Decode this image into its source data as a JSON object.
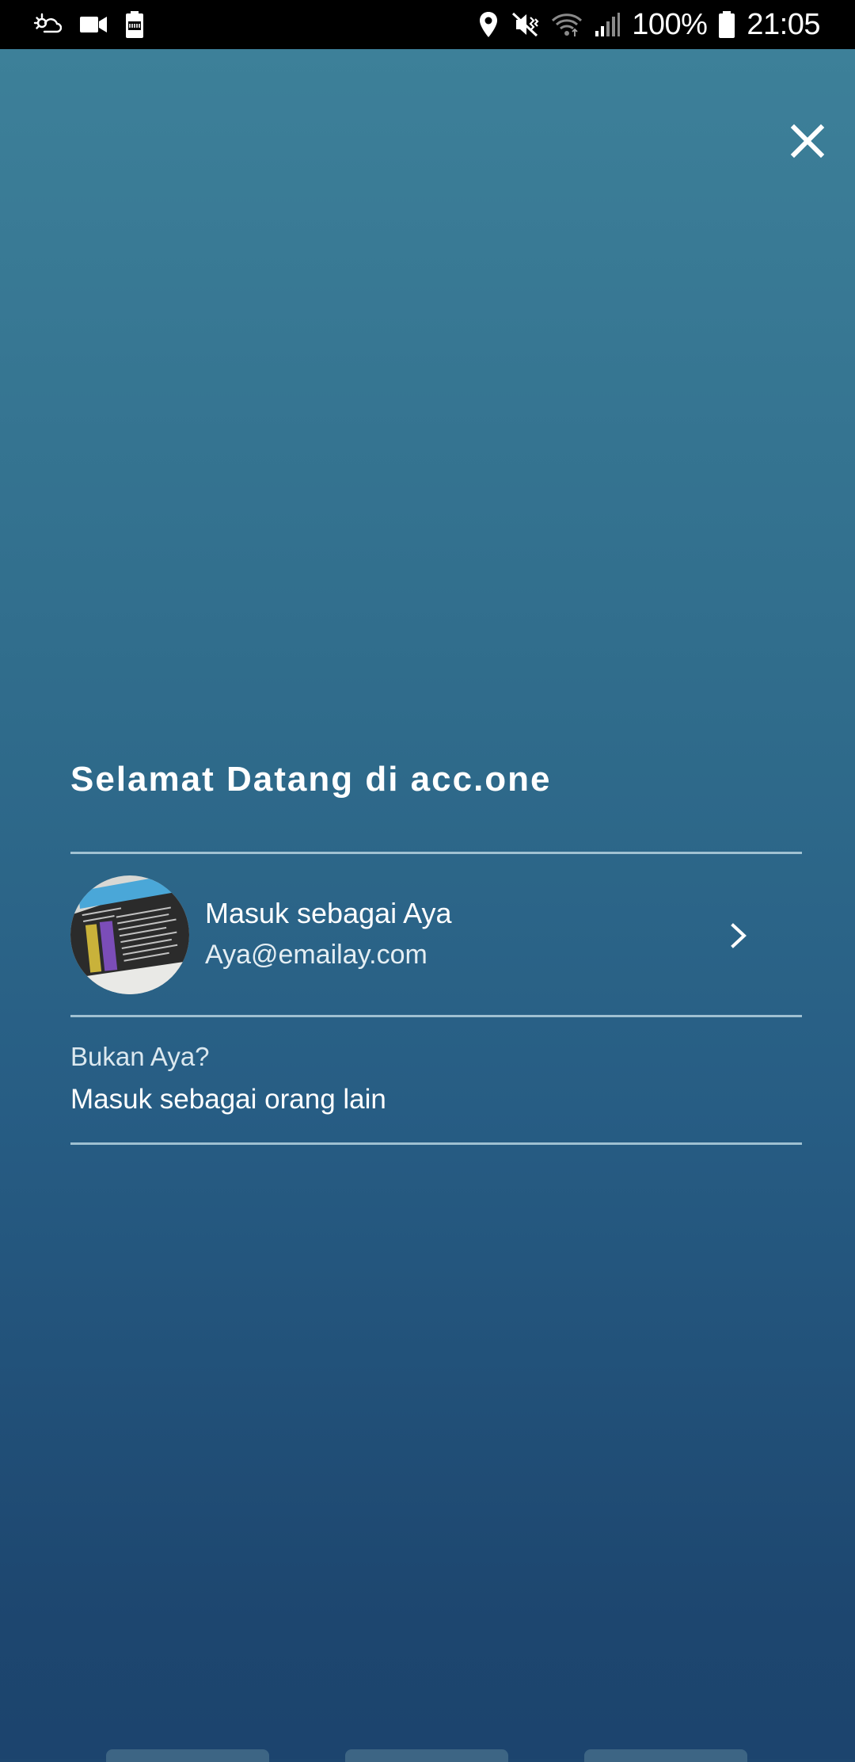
{
  "status_bar": {
    "battery_percent": "100%",
    "time": "21:05",
    "left_icons": [
      "daydream-icon",
      "video-camera-icon",
      "battery-saver-icon"
    ],
    "right_icons": [
      "location-icon",
      "mute-vibrate-icon",
      "wifi-icon",
      "signal-icon",
      "battery-icon"
    ]
  },
  "close_button": {
    "icon": "close-icon"
  },
  "welcome": {
    "title": "Selamat Datang di acc.one"
  },
  "account": {
    "sign_in_label": "Masuk sebagai Aya",
    "email": "Aya@emailay.com",
    "icon": "chevron-right-icon"
  },
  "other_account": {
    "question": "Bukan Aya?",
    "action": "Masuk sebagai orang lain"
  },
  "colors": {
    "gradient_top": "#3d8099",
    "gradient_bottom": "#1c446e",
    "divider": "#c8e1eb",
    "text": "#ffffff"
  }
}
